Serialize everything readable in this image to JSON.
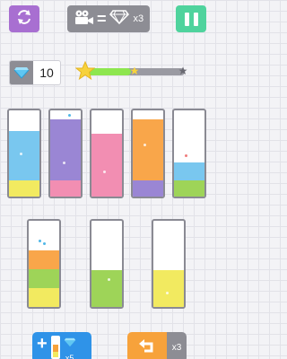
{
  "header": {
    "restart_icon": "restart-arrows-icon",
    "pause_icon": "pause-icon",
    "offer": {
      "icon": "video-camera-icon",
      "equals": "=",
      "reward_icon": "diamond-icon",
      "multiplier": "x3"
    }
  },
  "gems": {
    "icon": "diamond-icon",
    "count": "10"
  },
  "progress": {
    "fraction": 0.45,
    "star_icons": [
      "star-gold",
      "star-gold",
      "star-grey"
    ]
  },
  "tubes": [
    {
      "id": 1,
      "layers": [
        {
          "color": "yellow",
          "fraction": 0.19
        },
        {
          "color": "blue",
          "fraction": 0.57
        }
      ]
    },
    {
      "id": 2,
      "layers": [
        {
          "color": "pink",
          "fraction": 0.19
        },
        {
          "color": "purple",
          "fraction": 0.71
        }
      ]
    },
    {
      "id": 3,
      "layers": [
        {
          "color": "pink",
          "fraction": 0.73
        }
      ]
    },
    {
      "id": 4,
      "layers": [
        {
          "color": "purple",
          "fraction": 0.19
        },
        {
          "color": "orange",
          "fraction": 0.71
        }
      ]
    },
    {
      "id": 5,
      "layers": [
        {
          "color": "green",
          "fraction": 0.19
        },
        {
          "color": "blue",
          "fraction": 0.21
        }
      ]
    },
    {
      "id": 6,
      "layers": [
        {
          "color": "yellow",
          "fraction": 0.22
        },
        {
          "color": "green",
          "fraction": 0.22
        },
        {
          "color": "orange",
          "fraction": 0.22
        }
      ]
    },
    {
      "id": 7,
      "layers": [
        {
          "color": "green",
          "fraction": 0.43
        }
      ]
    },
    {
      "id": 8,
      "layers": [
        {
          "color": "yellow",
          "fraction": 0.43
        }
      ]
    }
  ],
  "controls": {
    "add_tube": {
      "plus": "+",
      "gem_icon": "diamond-icon",
      "multiplier": "x5"
    },
    "undo": {
      "icon": "undo-arrow-icon",
      "multiplier": "x3"
    }
  },
  "colors": {
    "blue": "#79c7ef",
    "yellow": "#f2ea60",
    "purple": "#9a86d4",
    "pink": "#f28eb2",
    "orange": "#f9a64a",
    "green": "#9ed458",
    "accent_restart": "#a86fd1",
    "accent_pause": "#4fd39d",
    "accent_add": "#2f93e8",
    "accent_undo": "#f7a23b"
  }
}
